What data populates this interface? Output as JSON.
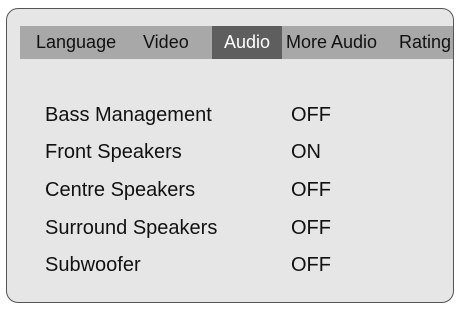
{
  "tabs": [
    {
      "label": "Language",
      "active": false
    },
    {
      "label": "Video",
      "active": false
    },
    {
      "label": "Audio",
      "active": true
    },
    {
      "label": "More Audio",
      "active": false
    },
    {
      "label": "Rating",
      "active": false
    }
  ],
  "settings": [
    {
      "label": "Bass Management",
      "value": "OFF"
    },
    {
      "label": "Front Speakers",
      "value": "ON"
    },
    {
      "label": "Centre Speakers",
      "value": "OFF"
    },
    {
      "label": "Surround Speakers",
      "value": "OFF"
    },
    {
      "label": "Subwoofer",
      "value": "OFF"
    }
  ],
  "colors": {
    "panel_background": "#e6e6e6",
    "tab_bar": "#a8a8a8",
    "active_tab": "#5e5e5e",
    "active_tab_text": "#ffffff",
    "text": "#111111",
    "border": "#555555"
  }
}
